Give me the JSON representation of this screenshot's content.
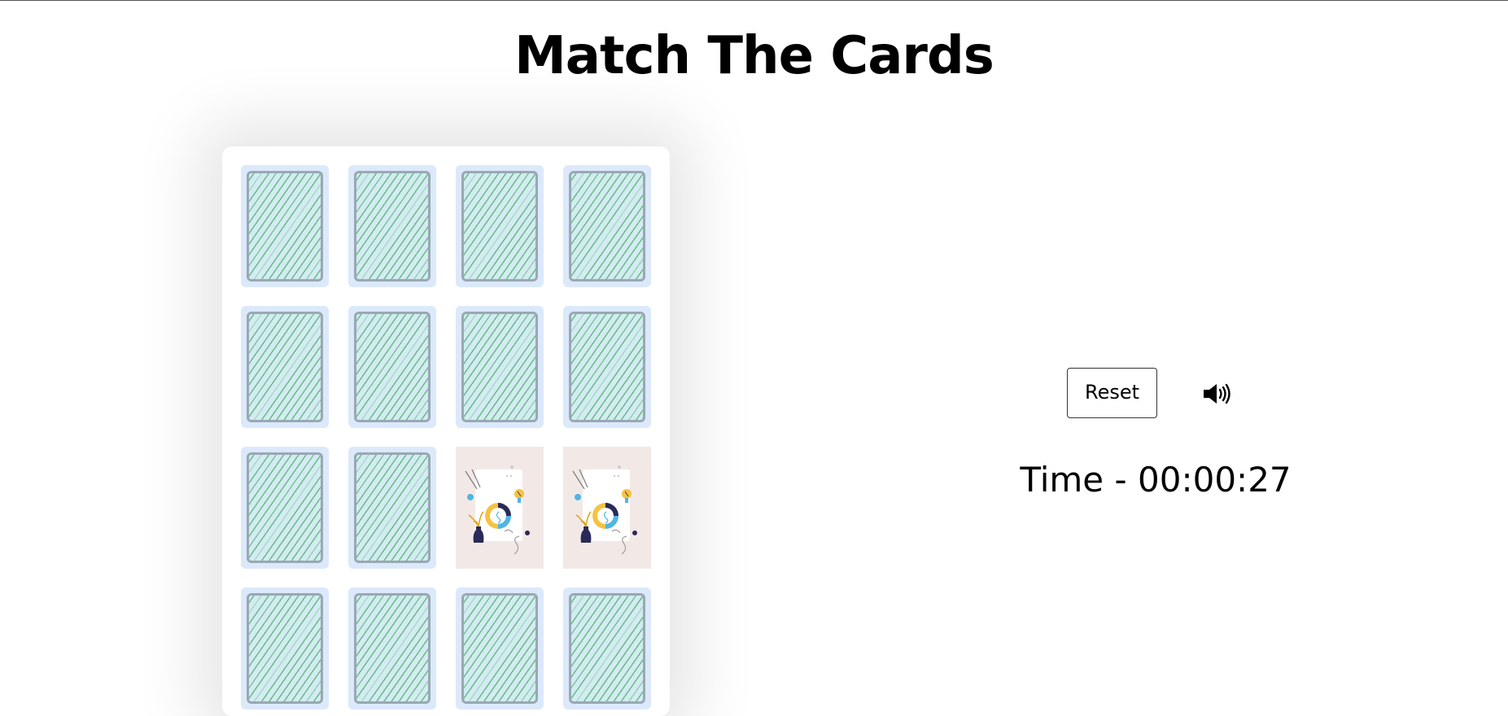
{
  "page": {
    "title": "Match The Cards"
  },
  "board": {
    "columns": 4,
    "cards": [
      {
        "state": "face-down"
      },
      {
        "state": "face-down"
      },
      {
        "state": "face-down"
      },
      {
        "state": "face-down"
      },
      {
        "state": "face-down"
      },
      {
        "state": "face-down"
      },
      {
        "state": "face-down"
      },
      {
        "state": "face-down"
      },
      {
        "state": "face-down"
      },
      {
        "state": "face-down"
      },
      {
        "state": "face-up",
        "image": "lightbulb-chart-illustration"
      },
      {
        "state": "face-up",
        "image": "lightbulb-chart-illustration"
      },
      {
        "state": "face-down"
      },
      {
        "state": "face-down"
      },
      {
        "state": "face-down"
      },
      {
        "state": "face-down"
      }
    ],
    "card_back_colors": {
      "frame": "#dbe9fb",
      "fill": "#d2ecf1",
      "stripe": "#6fb98a",
      "border": "#9aa8b4"
    }
  },
  "controls": {
    "reset_label": "Reset",
    "sound_icon": "speaker-volume-icon"
  },
  "timer": {
    "label": "Time - 00:00:27"
  }
}
